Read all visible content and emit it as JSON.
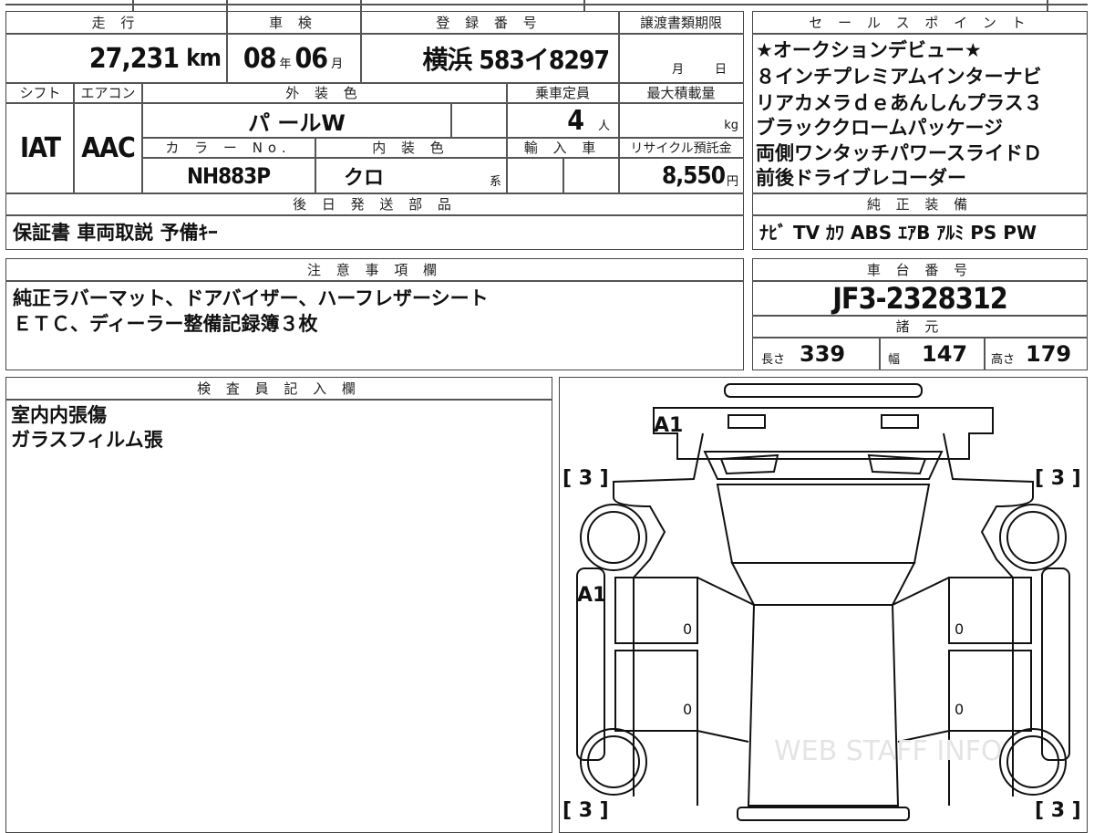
{
  "header": {
    "mileage_label": "走 行",
    "mileage_value": "27,231",
    "mileage_unit": "km",
    "inspection_label": "車 検",
    "inspection_year": "08",
    "inspection_year_unit": "年",
    "inspection_month": "06",
    "inspection_month_unit": "月",
    "registration_label": "登 録 番 号",
    "registration_value": "横浜 583イ8297",
    "transfer_label": "譲渡書類期限",
    "transfer_month_unit": "月",
    "transfer_day_unit": "日",
    "shift_label": "シフト",
    "shift_value": "IAT",
    "aircon_label": "エアコン",
    "aircon_value": "AAC",
    "exterior_color_label": "外 装 色",
    "exterior_color_value": "パ ールW",
    "capacity_label": "乗車定員",
    "capacity_value": "4",
    "capacity_unit": "人",
    "max_load_label": "最大積載量",
    "max_load_unit": "kg",
    "color_no_label": "カ ラ ー No.",
    "color_no_value": "NH883P",
    "interior_color_label": "内 装 色",
    "interior_color_value": "クロ",
    "interior_color_suffix": "系",
    "import_label": "輸 入 車",
    "recycle_label": "リサイクル預託金",
    "recycle_value": "8,550",
    "recycle_unit": "円",
    "later_parts_label": "後 日 発 送 部 品",
    "later_parts_value": "保証書  車両取説  予備ｷｰ"
  },
  "sales_points": {
    "label": "セ ー ル ス ポ イ ン ト",
    "lines": [
      "★オークションデビュー★",
      "８インチプレミアムインターナビ",
      "リアカメラｄｅあんしんプラス３",
      "ブラッククロームパッケージ",
      "両側ワンタッチパワースライドＤ",
      "前後ドライブレコーダー"
    ]
  },
  "equipment": {
    "label": "純 正 装 備",
    "value": "ﾅﾋﾞ  TV  ｶﾜ  ABS  ｴｱB  ｱﾙﾐ  PS  PW"
  },
  "notes": {
    "label": "注 意 事 項 欄",
    "lines": [
      "純正ラバーマット、ドアバイザー、ハーフレザーシート",
      "ＥＴＣ、ディーラー整備記録簿３枚"
    ]
  },
  "chassis": {
    "label": "車 台 番 号",
    "value": "JF3-2328312"
  },
  "specs": {
    "label": "諸 元",
    "length_label": "長さ",
    "length_value": "339",
    "width_label": "幅",
    "width_value": "147",
    "height_label": "高さ",
    "height_value": "179"
  },
  "inspector": {
    "label": "検 査 員 記 入 欄",
    "lines": [
      "室内内張傷",
      "ガラスフィルム張"
    ]
  },
  "diagram": {
    "mark_front": "A1",
    "mark_left": "A1",
    "tire_marks": [
      "[ 3 ]",
      "[ 3 ]",
      "[ 3 ]",
      "[ 3 ]"
    ],
    "seat_marks": [
      "0",
      "0",
      "0",
      "0"
    ],
    "watermark": "WEB STAFF INFO"
  }
}
